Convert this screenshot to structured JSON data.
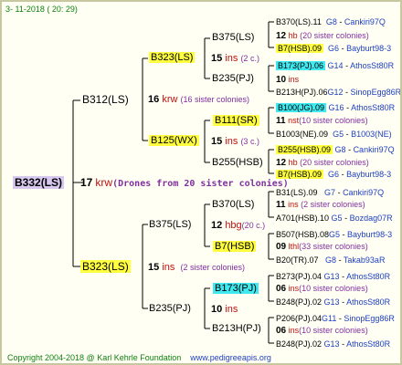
{
  "header": {
    "date": "3- 11-2018 ( 20: 29)"
  },
  "root": {
    "name": "B332(LS)",
    "number": "17",
    "krw": "krw",
    "drones": "(Drones from 20 sister colonies)"
  },
  "gen1": {
    "father": {
      "name": "B312(LS)",
      "number": "16",
      "krw": "krw",
      "sisters": "(16 sister colonies)"
    },
    "mother": {
      "name": "B323(LS)",
      "number": "15",
      "ins": "ins",
      "sisters": "(2 sister colonies)"
    }
  },
  "gen2": {
    "ff": {
      "name": "B323(LS)",
      "number": "15",
      "ins": "ins",
      "sisters": "(2 c.)"
    },
    "fm": {
      "name": "B125(WX)",
      "number": "15",
      "ins": "ins",
      "sisters": "(3 c.)"
    },
    "mf": {
      "name": "B375(LS)",
      "number": "12",
      "code": "hbg",
      "sisters": "(20 c.)"
    },
    "mm": {
      "name": "B235(PJ)",
      "number": "10",
      "ins": "ins"
    }
  },
  "gen3": {
    "a1": {
      "name": "B375(LS)"
    },
    "a2": {
      "name": "B235(PJ)",
      "number": "10",
      "ins": "ins"
    },
    "b1": {
      "name": "B111(SR)",
      "number": "11",
      "code": "nst",
      "sisters": "(10 sister colonies)"
    },
    "b2": {
      "name": "B255(HSB)",
      "number": "12",
      "code": "hb",
      "sisters": "(20 sister colonies)"
    },
    "c1": {
      "name": "B370(LS)",
      "number": "11",
      "ins": "ins",
      "sisters": "(2 sister colonies)"
    },
    "c2": {
      "name": "B7(HSB)",
      "number": "09",
      "code": "lthl",
      "sisters": "(33 sister colonies)"
    },
    "d1": {
      "name": "B173(PJ)",
      "number": "06",
      "ins": "ins",
      "sisters": "(10 sister colonies)"
    },
    "d2": {
      "name": "B213H(PJ)",
      "number": "06",
      "ins": "ins",
      "sisters": "(10 sister colonies)"
    }
  },
  "gen4": {
    "r1": {
      "name": "B370(LS).11",
      "g": "G8",
      "place": "Cankiri97Q"
    },
    "r1b": {
      "number": "12",
      "code": "hb",
      "sisters": "(20 sister colonies)"
    },
    "r2": {
      "name": "B7(HSB).09",
      "g": "G6",
      "place": "Bayburt98-3"
    },
    "r3": {
      "name": "B173(PJ).06",
      "g": "G14",
      "place": "AthosSt80R"
    },
    "r3b": {
      "number": "10",
      "ins": "ins"
    },
    "r4": {
      "name": "B213H(PJ).06",
      "g": "G12",
      "place": "SinopEgg86R"
    },
    "r5": {
      "name": "B100(JG).09",
      "g": "G16",
      "place": "AthosSt80R"
    },
    "r6": {
      "name": "B1003(NE).09",
      "g": "G5",
      "place": "B1003(NE)"
    },
    "r7": {
      "name": "B255(HSB).09",
      "g": "G8",
      "place": "Cankiri97Q"
    },
    "r8": {
      "name": "B7(HSB).09",
      "g": "G6",
      "place": "Bayburt98-3"
    },
    "r9": {
      "name": "B31(LS).09",
      "g": "G7",
      "place": "Cankiri97Q"
    },
    "r10": {
      "name": "A701(HSB).10",
      "g": "G5",
      "place": "Bozdag07R"
    },
    "r11": {
      "name": "B507(HSB).08",
      "g": "G5",
      "place": "Bayburt98-3"
    },
    "r12": {
      "name": "B20(TR).07",
      "g": "G8",
      "place": "Takab93aR"
    },
    "r13": {
      "name": "B273(PJ).04",
      "g": "G13",
      "place": "AthosSt80R"
    },
    "r14": {
      "name": "B248(PJ).02",
      "g": "G13",
      "place": "AthosSt80R"
    },
    "r15": {
      "name": "P206(PJ).04",
      "g": "G11",
      "place": "SinopEgg86R"
    },
    "r16": {
      "name": "B248(PJ).02",
      "g": "G13",
      "place": "AthosSt80R"
    }
  },
  "footer": {
    "copyright": "Copyright 2004-2018 @ Karl Kehrle Foundation",
    "url": "www.pedigreeapis.org"
  }
}
